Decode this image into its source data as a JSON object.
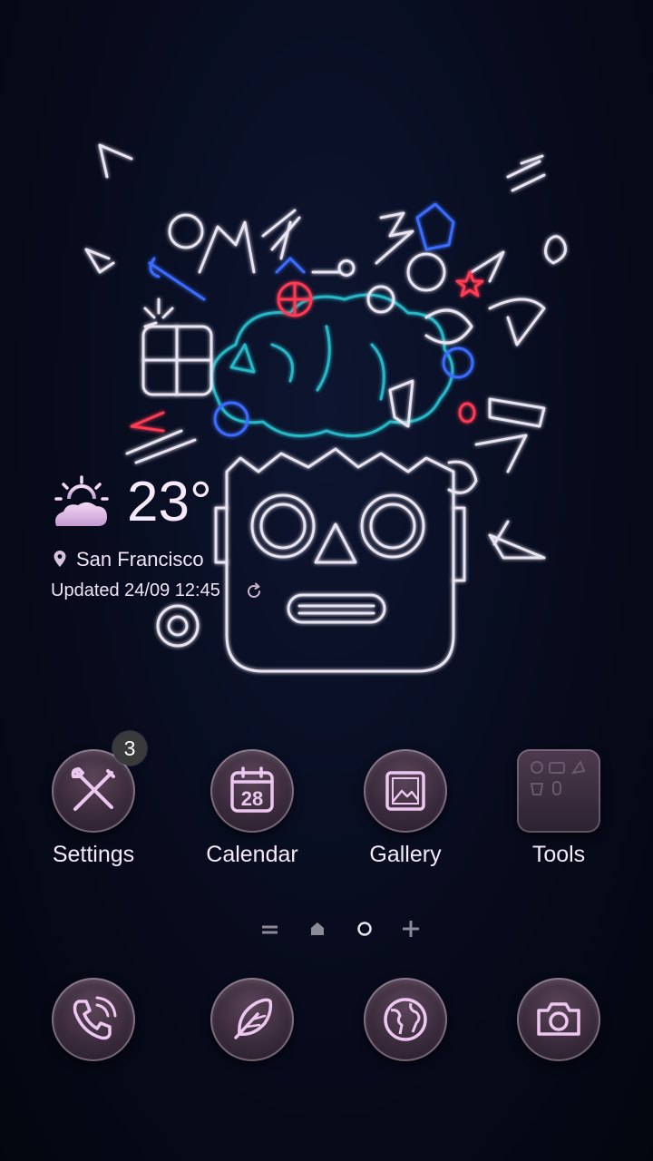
{
  "weather": {
    "icon": "partly-cloudy-sun-icon",
    "temperature": "23°",
    "location": "San Francisco",
    "updated": "Updated 24/09 12:45"
  },
  "apps": {
    "settings": {
      "label": "Settings",
      "icon": "tools-wrench-screwdriver-icon",
      "badge": "3"
    },
    "calendar": {
      "label": "Calendar",
      "icon": "calendar-icon",
      "day": "28"
    },
    "gallery": {
      "label": "Gallery",
      "icon": "picture-icon"
    },
    "tools": {
      "label": "Tools",
      "icon": "folder-icon"
    }
  },
  "pager": {
    "items": [
      "menu-indicator",
      "home-indicator",
      "page-dot",
      "add-page"
    ]
  },
  "dock": {
    "items": [
      "phone-icon",
      "feather-icon",
      "globe-icon",
      "camera-icon"
    ]
  },
  "colors": {
    "accent": "#f6eaf8",
    "icon_stroke": "#e9c9ee",
    "bubble": "#3a2b3c"
  }
}
